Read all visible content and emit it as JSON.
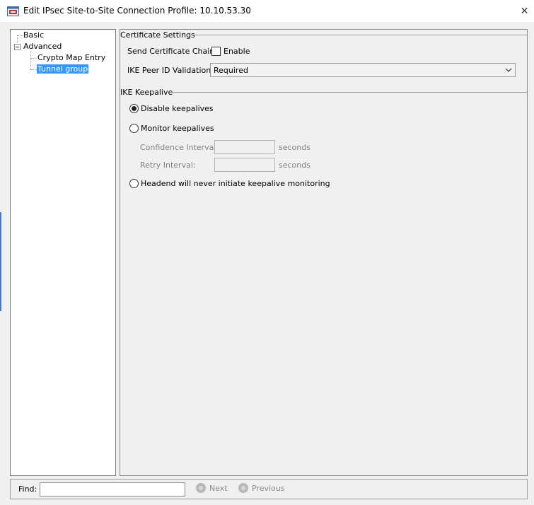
{
  "window": {
    "title": "Edit IPsec Site-to-Site Connection Profile: 10.10.53.30",
    "close_glyph": "✕"
  },
  "tree": {
    "items": [
      {
        "label": "Basic"
      },
      {
        "label": "Advanced"
      },
      {
        "label": "Crypto Map Entry"
      },
      {
        "label": "Tunnel group"
      }
    ]
  },
  "certificate_settings": {
    "group_title": "Certificate Settings",
    "send_chain_label": "Send Certificate Chain:",
    "enable_label": "Enable",
    "enable_checked": false,
    "peer_id_label": "IKE Peer ID Validation:",
    "peer_id_value": "Required"
  },
  "ike_keepalive": {
    "group_title": "IKE Keepalive",
    "disable_label": "Disable keepalives",
    "monitor_label": "Monitor keepalives",
    "confidence_label": "Confidence Interval:",
    "confidence_value": "",
    "confidence_unit": "seconds",
    "retry_label": "Retry Interval:",
    "retry_value": "",
    "retry_unit": "seconds",
    "headend_label": "Headend will never initiate keepalive monitoring",
    "selected": "disable"
  },
  "findbar": {
    "label": "Find:",
    "value": "",
    "next_label": "Next",
    "previous_label": "Previous"
  },
  "colors": {
    "selection": "#3399ff",
    "disabled_text": "#808080"
  }
}
